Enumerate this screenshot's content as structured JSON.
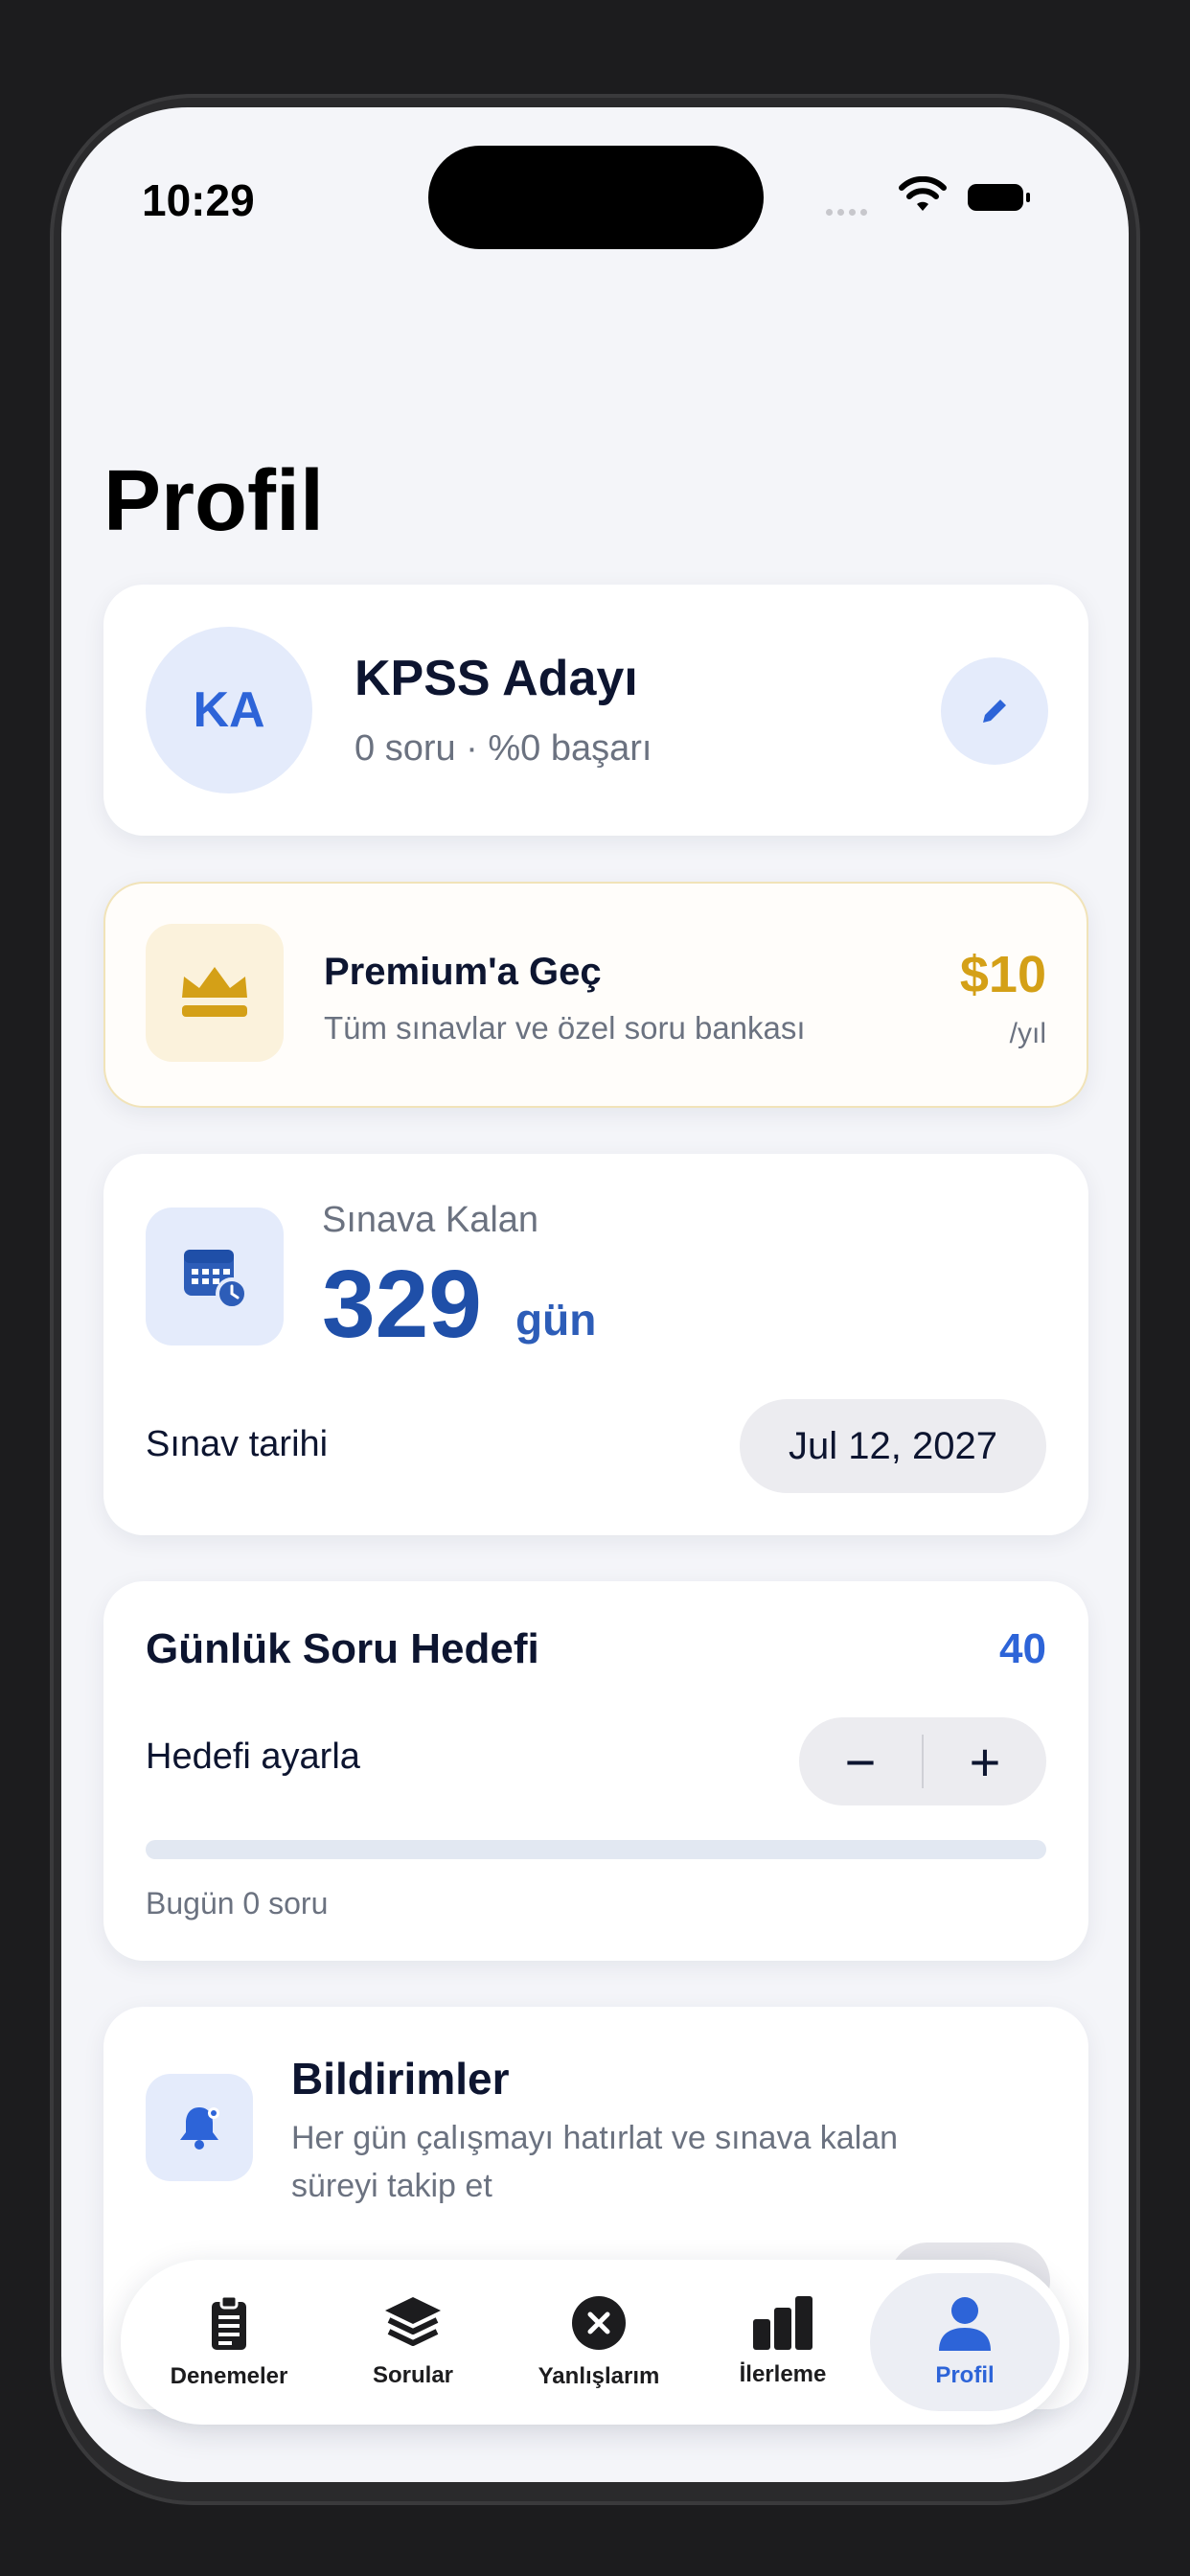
{
  "status_bar": {
    "time": "10:29"
  },
  "page": {
    "title": "Profil"
  },
  "profile": {
    "initials": "KA",
    "name": "KPSS Adayı",
    "subtitle": "0 soru · %0 başarı",
    "edit_icon": "pencil-icon"
  },
  "premium": {
    "icon": "crown-icon",
    "title": "Premium'a Geç",
    "description": "Tüm sınavlar ve özel soru bankası",
    "price": "$10",
    "period": "/yıl",
    "accent_color": "#d4a017"
  },
  "exam": {
    "icon": "calendar-clock-icon",
    "label": "Sınava Kalan",
    "days": "329",
    "unit": "gün",
    "date_label": "Sınav tarihi",
    "date_value": "Jul 12, 2027"
  },
  "goal": {
    "title": "Günlük Soru Hedefi",
    "value": "40",
    "adjust_label": "Hedefi ayarla",
    "minus": "−",
    "plus": "+",
    "progress": 0,
    "today": "Bugün 0 soru"
  },
  "notifications": {
    "icon": "bell-icon",
    "title": "Bildirimler",
    "description": "Her gün çalışmayı hatırlat ve sınava kalan süreyi takip et",
    "enabled": false
  },
  "tabs": [
    {
      "label": "Denemeler",
      "icon": "clipboard-icon",
      "active": false
    },
    {
      "label": "Sorular",
      "icon": "layers-icon",
      "active": false
    },
    {
      "label": "Yanlışlarım",
      "icon": "x-circle-icon",
      "active": false
    },
    {
      "label": "İlerleme",
      "icon": "bar-chart-icon",
      "active": false
    },
    {
      "label": "Profil",
      "icon": "person-icon",
      "active": true
    }
  ],
  "colors": {
    "primary": "#2d64d8",
    "background": "#f4f5f9"
  }
}
